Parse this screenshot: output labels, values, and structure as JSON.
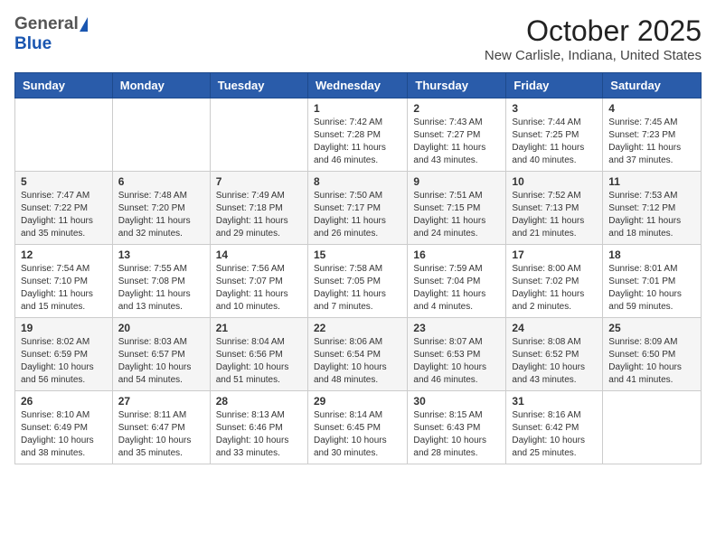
{
  "header": {
    "logo_general": "General",
    "logo_blue": "Blue",
    "month_year": "October 2025",
    "location": "New Carlisle, Indiana, United States"
  },
  "weekdays": [
    "Sunday",
    "Monday",
    "Tuesday",
    "Wednesday",
    "Thursday",
    "Friday",
    "Saturday"
  ],
  "weeks": [
    [
      {
        "day": "",
        "info": ""
      },
      {
        "day": "",
        "info": ""
      },
      {
        "day": "",
        "info": ""
      },
      {
        "day": "1",
        "info": "Sunrise: 7:42 AM\nSunset: 7:28 PM\nDaylight: 11 hours\nand 46 minutes."
      },
      {
        "day": "2",
        "info": "Sunrise: 7:43 AM\nSunset: 7:27 PM\nDaylight: 11 hours\nand 43 minutes."
      },
      {
        "day": "3",
        "info": "Sunrise: 7:44 AM\nSunset: 7:25 PM\nDaylight: 11 hours\nand 40 minutes."
      },
      {
        "day": "4",
        "info": "Sunrise: 7:45 AM\nSunset: 7:23 PM\nDaylight: 11 hours\nand 37 minutes."
      }
    ],
    [
      {
        "day": "5",
        "info": "Sunrise: 7:47 AM\nSunset: 7:22 PM\nDaylight: 11 hours\nand 35 minutes."
      },
      {
        "day": "6",
        "info": "Sunrise: 7:48 AM\nSunset: 7:20 PM\nDaylight: 11 hours\nand 32 minutes."
      },
      {
        "day": "7",
        "info": "Sunrise: 7:49 AM\nSunset: 7:18 PM\nDaylight: 11 hours\nand 29 minutes."
      },
      {
        "day": "8",
        "info": "Sunrise: 7:50 AM\nSunset: 7:17 PM\nDaylight: 11 hours\nand 26 minutes."
      },
      {
        "day": "9",
        "info": "Sunrise: 7:51 AM\nSunset: 7:15 PM\nDaylight: 11 hours\nand 24 minutes."
      },
      {
        "day": "10",
        "info": "Sunrise: 7:52 AM\nSunset: 7:13 PM\nDaylight: 11 hours\nand 21 minutes."
      },
      {
        "day": "11",
        "info": "Sunrise: 7:53 AM\nSunset: 7:12 PM\nDaylight: 11 hours\nand 18 minutes."
      }
    ],
    [
      {
        "day": "12",
        "info": "Sunrise: 7:54 AM\nSunset: 7:10 PM\nDaylight: 11 hours\nand 15 minutes."
      },
      {
        "day": "13",
        "info": "Sunrise: 7:55 AM\nSunset: 7:08 PM\nDaylight: 11 hours\nand 13 minutes."
      },
      {
        "day": "14",
        "info": "Sunrise: 7:56 AM\nSunset: 7:07 PM\nDaylight: 11 hours\nand 10 minutes."
      },
      {
        "day": "15",
        "info": "Sunrise: 7:58 AM\nSunset: 7:05 PM\nDaylight: 11 hours\nand 7 minutes."
      },
      {
        "day": "16",
        "info": "Sunrise: 7:59 AM\nSunset: 7:04 PM\nDaylight: 11 hours\nand 4 minutes."
      },
      {
        "day": "17",
        "info": "Sunrise: 8:00 AM\nSunset: 7:02 PM\nDaylight: 11 hours\nand 2 minutes."
      },
      {
        "day": "18",
        "info": "Sunrise: 8:01 AM\nSunset: 7:01 PM\nDaylight: 10 hours\nand 59 minutes."
      }
    ],
    [
      {
        "day": "19",
        "info": "Sunrise: 8:02 AM\nSunset: 6:59 PM\nDaylight: 10 hours\nand 56 minutes."
      },
      {
        "day": "20",
        "info": "Sunrise: 8:03 AM\nSunset: 6:57 PM\nDaylight: 10 hours\nand 54 minutes."
      },
      {
        "day": "21",
        "info": "Sunrise: 8:04 AM\nSunset: 6:56 PM\nDaylight: 10 hours\nand 51 minutes."
      },
      {
        "day": "22",
        "info": "Sunrise: 8:06 AM\nSunset: 6:54 PM\nDaylight: 10 hours\nand 48 minutes."
      },
      {
        "day": "23",
        "info": "Sunrise: 8:07 AM\nSunset: 6:53 PM\nDaylight: 10 hours\nand 46 minutes."
      },
      {
        "day": "24",
        "info": "Sunrise: 8:08 AM\nSunset: 6:52 PM\nDaylight: 10 hours\nand 43 minutes."
      },
      {
        "day": "25",
        "info": "Sunrise: 8:09 AM\nSunset: 6:50 PM\nDaylight: 10 hours\nand 41 minutes."
      }
    ],
    [
      {
        "day": "26",
        "info": "Sunrise: 8:10 AM\nSunset: 6:49 PM\nDaylight: 10 hours\nand 38 minutes."
      },
      {
        "day": "27",
        "info": "Sunrise: 8:11 AM\nSunset: 6:47 PM\nDaylight: 10 hours\nand 35 minutes."
      },
      {
        "day": "28",
        "info": "Sunrise: 8:13 AM\nSunset: 6:46 PM\nDaylight: 10 hours\nand 33 minutes."
      },
      {
        "day": "29",
        "info": "Sunrise: 8:14 AM\nSunset: 6:45 PM\nDaylight: 10 hours\nand 30 minutes."
      },
      {
        "day": "30",
        "info": "Sunrise: 8:15 AM\nSunset: 6:43 PM\nDaylight: 10 hours\nand 28 minutes."
      },
      {
        "day": "31",
        "info": "Sunrise: 8:16 AM\nSunset: 6:42 PM\nDaylight: 10 hours\nand 25 minutes."
      },
      {
        "day": "",
        "info": ""
      }
    ]
  ]
}
